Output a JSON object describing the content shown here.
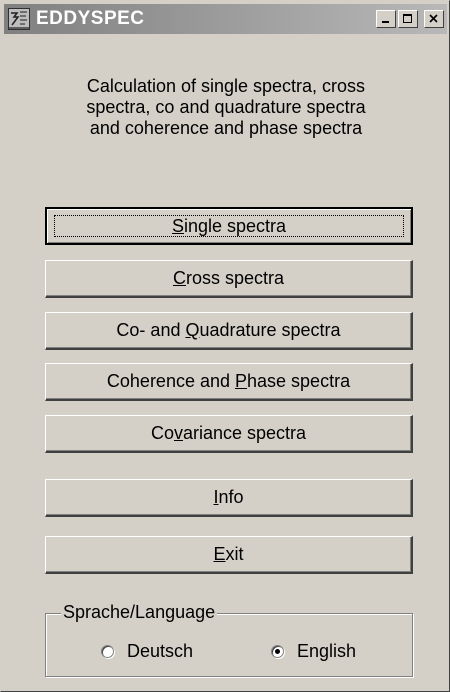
{
  "window": {
    "title": "EDDYSPEC",
    "icon": "app-icon",
    "controls": {
      "minimize": "minimize-icon",
      "maximize": "maximize-icon",
      "close": "close-icon"
    }
  },
  "description": "Calculation of single spectra, cross\nspectra, co and quadrature spectra\nand coherence and phase spectra",
  "buttons": [
    {
      "pre": "",
      "key": "S",
      "post": "ingle spectra",
      "default": true
    },
    {
      "pre": "",
      "key": "C",
      "post": "ross spectra"
    },
    {
      "pre": "Co- and ",
      "key": "Q",
      "post": "uadrature spectra"
    },
    {
      "pre": "Coherence and ",
      "key": "P",
      "post": "hase spectra"
    },
    {
      "pre": "Co",
      "key": "v",
      "post": "ariance spectra"
    },
    {
      "pre": "",
      "key": "I",
      "post": "nfo"
    },
    {
      "pre": "",
      "key": "E",
      "post": "xit"
    }
  ],
  "language": {
    "group_label": "Sprache/Language",
    "options": [
      {
        "label": "Deutsch",
        "selected": false
      },
      {
        "label": "English",
        "selected": true
      }
    ]
  }
}
